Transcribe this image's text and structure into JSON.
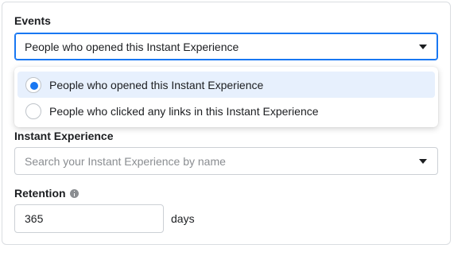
{
  "events": {
    "label": "Events",
    "selected": "People who opened this Instant Experience",
    "options": [
      {
        "label": "People who opened this Instant Experience",
        "selected": true
      },
      {
        "label": "People who clicked any links in this Instant Experience",
        "selected": false
      }
    ]
  },
  "instant_experience": {
    "label": "Instant Experience",
    "placeholder": "Search your Instant Experience by name"
  },
  "retention": {
    "label": "Retention",
    "value": "365",
    "unit": "days"
  },
  "colors": {
    "accent": "#1877f2",
    "selected_bg": "#e7f0fd"
  }
}
